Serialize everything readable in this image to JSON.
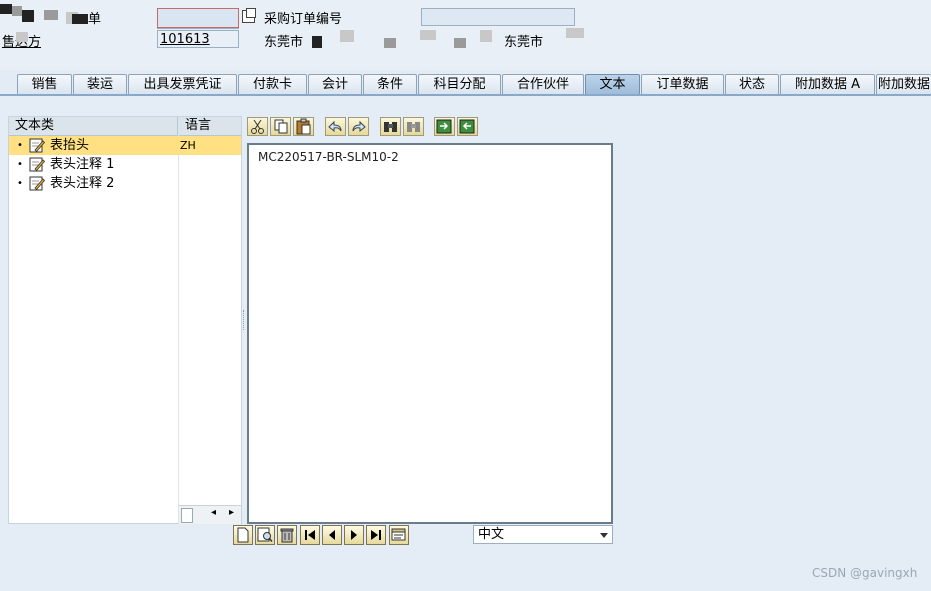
{
  "header": {
    "order_label": "单",
    "sold_to_label": "售达方",
    "sold_to_value": "101613",
    "po_number_label": "采购订单编号",
    "city_left": "东莞市",
    "city_right": "东莞市"
  },
  "tabs": [
    {
      "label": "销售"
    },
    {
      "label": "装运"
    },
    {
      "label": "出具发票凭证"
    },
    {
      "label": "付款卡"
    },
    {
      "label": "会计"
    },
    {
      "label": "条件"
    },
    {
      "label": "科目分配"
    },
    {
      "label": "合作伙伴"
    },
    {
      "label": "文本",
      "active": true
    },
    {
      "label": "订单数据"
    },
    {
      "label": "状态"
    },
    {
      "label": "附加数据 A"
    },
    {
      "label": "附加数据"
    }
  ],
  "tree": {
    "col_text_type": "文本类",
    "col_language": "语言",
    "items": [
      {
        "label": "表抬头",
        "lang": "ZH",
        "selected": true
      },
      {
        "label": "表头注释 1",
        "lang": ""
      },
      {
        "label": "表头注释 2",
        "lang": ""
      }
    ]
  },
  "editor": {
    "text": "MC220517-BR-SLM10-2"
  },
  "language_select": {
    "value": "中文"
  },
  "watermark": "CSDN @gavingxh",
  "colors": {
    "selected_row": "#ffe083",
    "active_tab": "#a9c4e0",
    "background": "#e3ecf5"
  }
}
